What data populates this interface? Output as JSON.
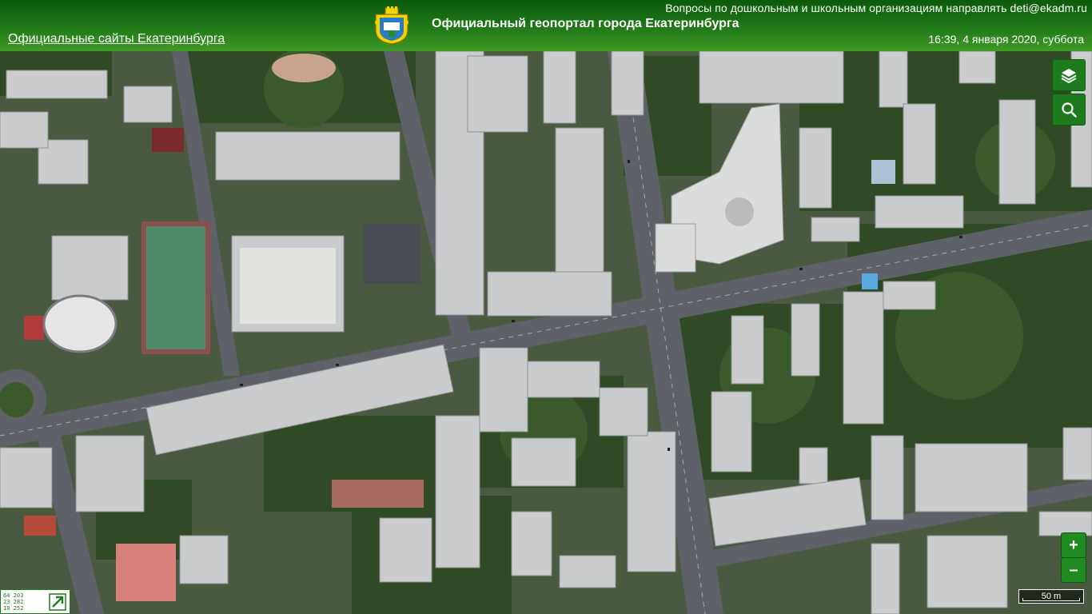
{
  "header": {
    "notice": "Вопросы по дошкольным и школьным организациям направлять deti@ekadm.ru",
    "sites_link": "Официальные сайты Екатеринбурга",
    "title": "Официальный геопортал города Екатеринбурга",
    "datetime": "16:39, 4 января 2020, суббота"
  },
  "controls": {
    "zoom_in": "+",
    "zoom_out": "–",
    "scale_label": "50 m",
    "overview_coords": [
      "64 203",
      "23 282",
      "10 252"
    ]
  },
  "colors": {
    "header_dark": "#0c5a0c",
    "header_light": "#3f9a27",
    "button_green": "#1d7a1d"
  }
}
